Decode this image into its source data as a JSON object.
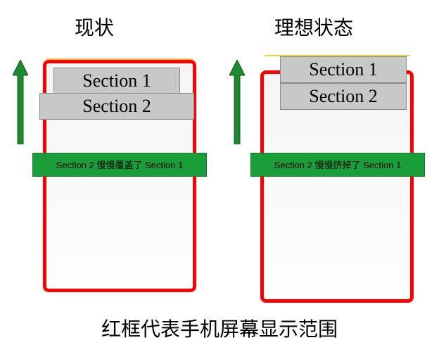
{
  "titles": {
    "left": "现状",
    "right": "理想状态"
  },
  "sections": {
    "left1": "Section 1",
    "left2": "Section 2",
    "right1": "Section 1",
    "right2": "Section 2"
  },
  "banners": {
    "left": "Section 2 慢慢覆盖了 Section 1",
    "right": "Section 2 慢慢挤掉了 Section 1"
  },
  "caption": "红框代表手机屏幕显示范围",
  "colors": {
    "phone_border": "#ff0000",
    "arrow": "#1e8a2f",
    "section_bg": "#c8c8c8",
    "banner_bg": "#1a9e3a"
  },
  "watermark": ""
}
